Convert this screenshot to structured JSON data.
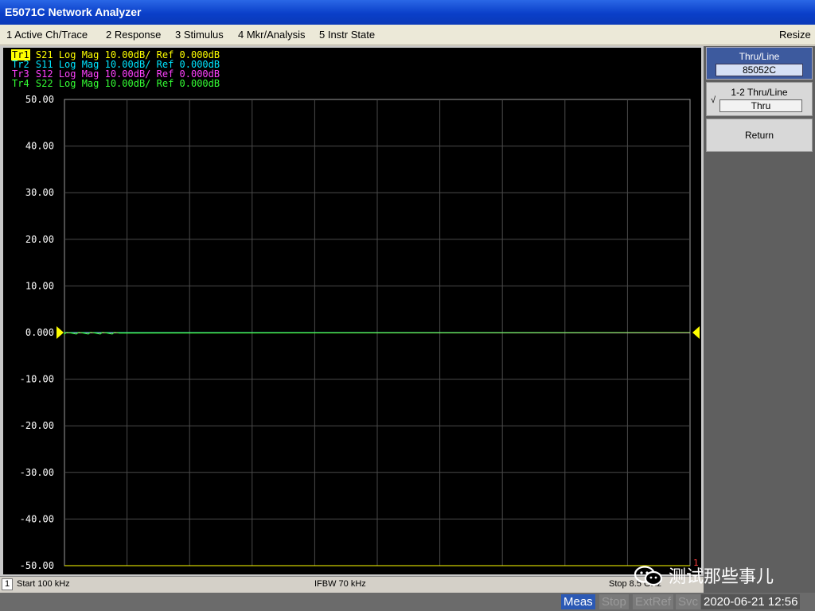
{
  "window": {
    "title": "E5071C Network Analyzer"
  },
  "menu": {
    "items": [
      "1 Active Ch/Trace",
      "2 Response",
      "3 Stimulus",
      "4 Mkr/Analysis",
      "5 Instr State"
    ],
    "resize_label": "Resize"
  },
  "traces": [
    {
      "label": "Tr1",
      "param": "S21",
      "format": "Log Mag",
      "scale": "10.00dB/",
      "ref": "Ref 0.000dB",
      "color": "#ffff00",
      "active": true
    },
    {
      "label": "Tr2",
      "param": "S11",
      "format": "Log Mag",
      "scale": "10.00dB/",
      "ref": "Ref 0.000dB",
      "color": "#00e5ff",
      "active": false
    },
    {
      "label": "Tr3",
      "param": "S12",
      "format": "Log Mag",
      "scale": "10.00dB/",
      "ref": "Ref 0.000dB",
      "color": "#ff40ff",
      "active": false
    },
    {
      "label": "Tr4",
      "param": "S22",
      "format": "Log Mag",
      "scale": "10.00dB/",
      "ref": "Ref 0.000dB",
      "color": "#33ff33",
      "active": false
    }
  ],
  "chart_data": {
    "type": "line",
    "y_ticks": [
      "50.00",
      "40.00",
      "30.00",
      "20.00",
      "10.00",
      "0.000",
      "-10.00",
      "-20.00",
      "-30.00",
      "-40.00",
      "-50.00"
    ],
    "ylim": [
      -50,
      50
    ],
    "x_divisions": 10,
    "grid": true,
    "reference_level": 0,
    "series_level_db": 0
  },
  "channel": {
    "number": "1",
    "marker_num": "1"
  },
  "status": {
    "start": "Start 100 kHz",
    "ifbw": "IFBW 70 kHz",
    "stop": "Stop 8.5 GHz"
  },
  "bottom": {
    "meas": "Meas",
    "stop": "Stop",
    "extref": "ExtRef",
    "svc": "Svc",
    "datetime": "2020-06-21 12:56"
  },
  "softkeys": {
    "header_title": "Thru/Line",
    "header_value": "85052C",
    "thru_title": "1-2 Thru/Line",
    "thru_value": "Thru",
    "thru_check": "√",
    "return_label": "Return"
  },
  "watermark": {
    "text": "测试那些事儿"
  }
}
